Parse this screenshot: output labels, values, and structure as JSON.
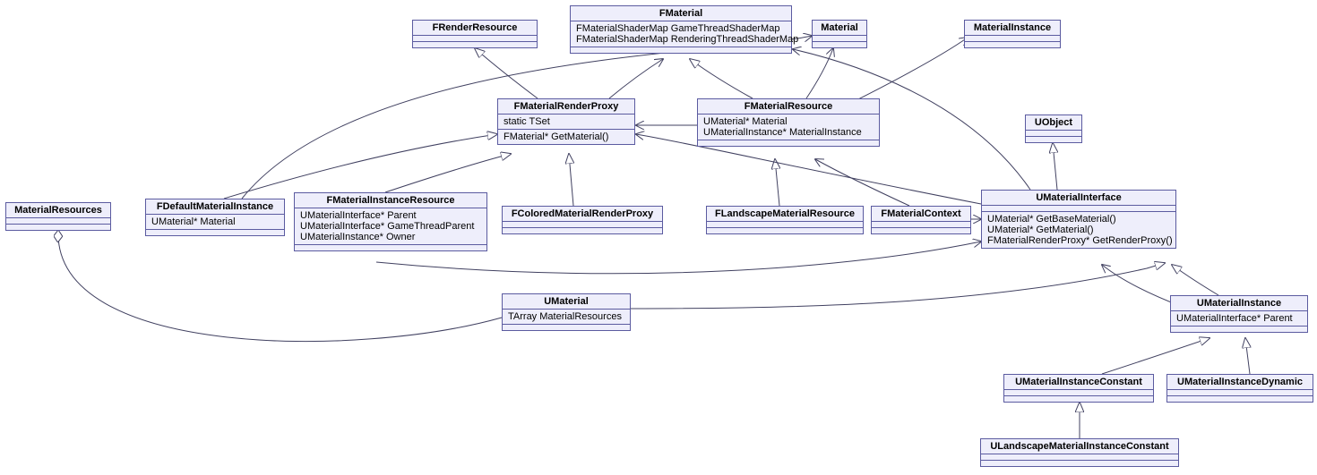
{
  "nodes": {
    "FRenderResource": {
      "title": "FRenderResource"
    },
    "FMaterial": {
      "title": "FMaterial",
      "attrs": [
        "FMaterialShaderMap GameThreadShaderMap",
        "FMaterialShaderMap RenderingThreadShaderMap"
      ]
    },
    "Material": {
      "title": "Material"
    },
    "MaterialInstance": {
      "title": "MaterialInstance"
    },
    "FMaterialRenderProxy": {
      "title": "FMaterialRenderProxy",
      "attrs": [
        "static TSet"
      ],
      "ops": [
        "FMaterial* GetMaterial()"
      ]
    },
    "FMaterialResource": {
      "title": "FMaterialResource",
      "attrs": [
        "UMaterial* Material",
        "UMaterialInstance* MaterialInstance"
      ]
    },
    "UObject": {
      "title": "UObject"
    },
    "MaterialResources": {
      "title": "MaterialResources"
    },
    "FDefaultMaterialInstance": {
      "title": "FDefaultMaterialInstance",
      "attrs": [
        "UMaterial* Material"
      ]
    },
    "FMaterialInstanceResource": {
      "title": "FMaterialInstanceResource",
      "attrs": [
        "UMaterialInterface* Parent",
        "UMaterialInterface* GameThreadParent",
        "UMaterialInstance* Owner"
      ]
    },
    "FColoredMaterialRenderProxy": {
      "title": "FColoredMaterialRenderProxy"
    },
    "FLandscapeMaterialResource": {
      "title": "FLandscapeMaterialResource"
    },
    "FMaterialContext": {
      "title": "FMaterialContext"
    },
    "UMaterialInterface": {
      "title": "UMaterialInterface",
      "ops": [
        "UMaterial* GetBaseMaterial()",
        "UMaterial* GetMaterial()",
        "FMaterialRenderProxy* GetRenderProxy()"
      ]
    },
    "UMaterial": {
      "title": "UMaterial",
      "attrs": [
        "TArray MaterialResources"
      ]
    },
    "UMaterialInstance": {
      "title": "UMaterialInstance",
      "attrs": [
        "UMaterialInterface* Parent"
      ]
    },
    "UMaterialInstanceConstant": {
      "title": "UMaterialInstanceConstant"
    },
    "UMaterialInstanceDynamic": {
      "title": "UMaterialInstanceDynamic"
    },
    "ULandscapeMaterialInstanceConstant": {
      "title": "ULandscapeMaterialInstanceConstant"
    }
  }
}
